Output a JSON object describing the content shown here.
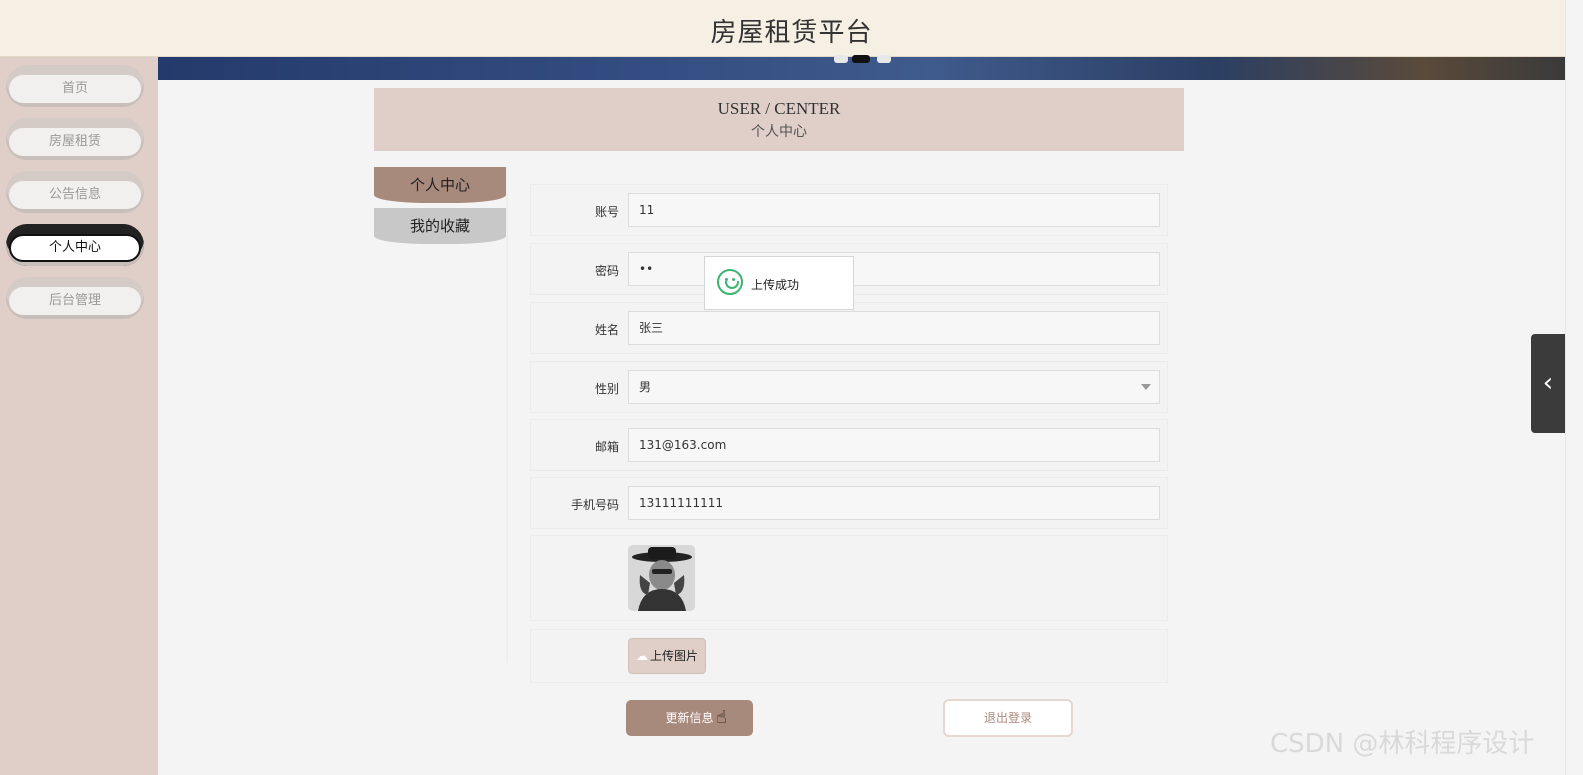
{
  "header": {
    "site_title": "房屋租赁平台"
  },
  "sidebar": {
    "items": [
      {
        "label": "首页",
        "active": false
      },
      {
        "label": "房屋租赁",
        "active": false
      },
      {
        "label": "公告信息",
        "active": false
      },
      {
        "label": "个人中心",
        "active": true
      },
      {
        "label": "后台管理",
        "active": false
      }
    ]
  },
  "carousel": {
    "dots": 3,
    "active_dot": 1
  },
  "page_header": {
    "en": "USER / CENTER",
    "cn": "个人中心"
  },
  "tabs": [
    {
      "label": "个人中心",
      "active": true
    },
    {
      "label": "我的收藏",
      "active": false
    }
  ],
  "form": {
    "account_label": "账号",
    "account_value": "11",
    "password_label": "密码",
    "password_value": "••",
    "name_label": "姓名",
    "name_value": "张三",
    "gender_label": "性别",
    "gender_value": "男",
    "email_label": "邮箱",
    "email_value": "131@163.com",
    "phone_label": "手机号码",
    "phone_value": "13111111111",
    "upload_label": "上传图片"
  },
  "buttons": {
    "update": "更新信息",
    "logout": "退出登录"
  },
  "toast": {
    "message": "上传成功"
  },
  "watermark": "CSDN @林科程序设计",
  "colors": {
    "accent": "#a88a7c",
    "sidebar_bg": "#dfcfc8",
    "header_bg": "#f6efe4",
    "success": "#3cb371"
  }
}
